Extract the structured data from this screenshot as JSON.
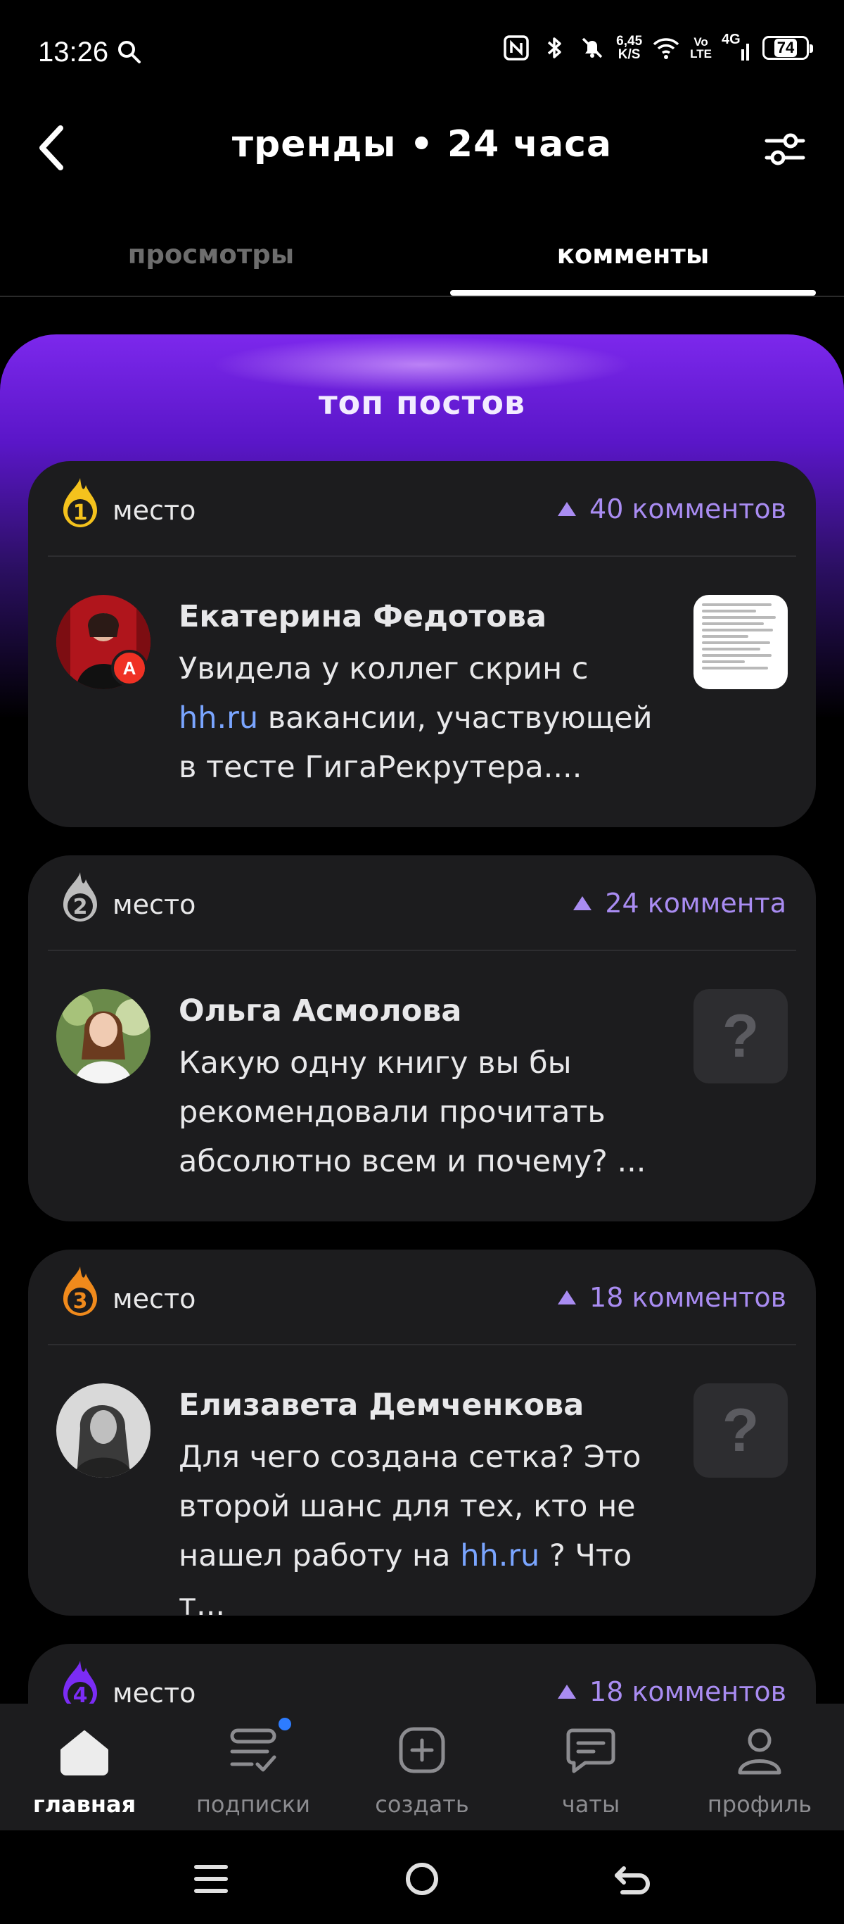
{
  "status_bar": {
    "time": "13:26",
    "net_speed_value": "6,45",
    "net_speed_unit": "K/S",
    "volte_top": "Vo",
    "volte_bottom": "LTE",
    "network": "4G",
    "battery": "74",
    "icons": [
      "search-icon",
      "nfc-icon",
      "bluetooth-icon",
      "mute-icon",
      "wifi-icon",
      "signal-icon"
    ]
  },
  "header": {
    "title": "тренды • 24 часа",
    "back_icon": "chevron-left-icon",
    "filter_icon": "sliders-icon"
  },
  "tabs": [
    {
      "label": "просмотры",
      "active": false
    },
    {
      "label": "комменты",
      "active": true
    }
  ],
  "section": {
    "title": "топ постов"
  },
  "posts": [
    {
      "rank": "1",
      "place_label": "место",
      "comments": "40 комментов",
      "author": "Екатерина Федотова",
      "text_before": "Увидела у коллег скрин с ",
      "link": "hh.ru",
      "text_after": " вакансии, участвующей в тесте ГигаРекрутера....",
      "badge_color": "#f4c21d",
      "has_image": true,
      "avatar_badge": "А"
    },
    {
      "rank": "2",
      "place_label": "место",
      "comments": "24 коммента",
      "author": "Ольга Асмолова",
      "text": "Какую одну книгу вы бы рекомендовали прочитать абсолютно всем и почему? ...",
      "badge_color": "#bdbdbd",
      "thumb": "?"
    },
    {
      "rank": "3",
      "place_label": "место",
      "comments": "18 комментов",
      "author": "Елизавета Демченкова",
      "text_before": "Для чего создана сетка? Это второй шанс для тех, кто не нашел работу на ",
      "link": "hh.ru",
      "text_after": " ? Что т...",
      "badge_color": "#f08a1c",
      "thumb": "?"
    },
    {
      "rank": "4",
      "place_label": "место",
      "comments": "18 комментов",
      "badge_color": "#7b2cf5"
    }
  ],
  "bottom_nav": [
    {
      "label": "главная",
      "icon": "home-icon",
      "active": true
    },
    {
      "label": "подписки",
      "icon": "subscriptions-icon",
      "active": false,
      "dot": true
    },
    {
      "label": "создать",
      "icon": "create-icon",
      "active": false
    },
    {
      "label": "чаты",
      "icon": "chat-icon",
      "active": false
    },
    {
      "label": "профиль",
      "icon": "profile-icon",
      "active": false
    }
  ],
  "colors": {
    "accent": "#a98cf2",
    "link": "#7aa5ff",
    "card": "#1c1c1e",
    "gradient_top": "#7c28ec"
  }
}
